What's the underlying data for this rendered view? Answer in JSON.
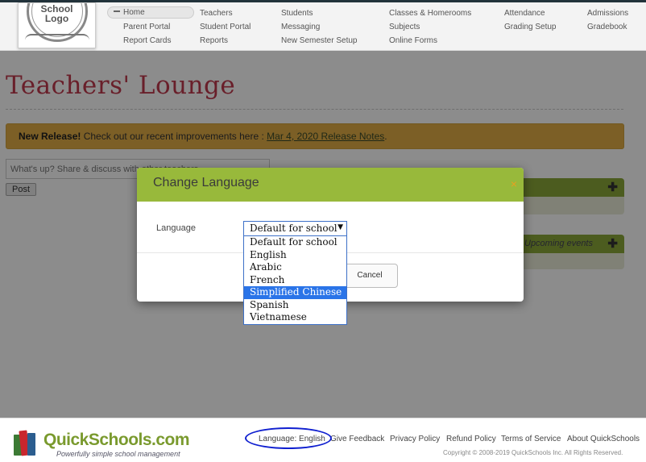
{
  "nav": {
    "home": "Home",
    "parent_portal": "Parent Portal",
    "report_cards": "Report Cards",
    "teachers": "Teachers",
    "student_portal": "Student Portal",
    "reports": "Reports",
    "students": "Students",
    "messaging": "Messaging",
    "new_semester_setup": "New Semester Setup",
    "classes_homerooms": "Classes & Homerooms",
    "subjects": "Subjects",
    "online_forms": "Online Forms",
    "attendance": "Attendance",
    "grading_setup": "Grading Setup",
    "admissions": "Admissions",
    "gradebook": "Gradebook"
  },
  "logo": {
    "line1": "School",
    "line2": "Logo"
  },
  "page_title": "Teachers' Lounge",
  "release": {
    "bold": "New Release!",
    "text": " Check out our recent improvements here : ",
    "link": "Mar 4, 2020 Release Notes",
    "end": "."
  },
  "status": {
    "placeholder": "What's up?  Share & discuss with other teachers",
    "post_label": "Post"
  },
  "panels": {
    "upcoming_events": "Upcoming events"
  },
  "modal": {
    "title": "Change Language",
    "close": "×",
    "language_label": "Language",
    "selected_value": "Default for school",
    "options": [
      "Default for school",
      "English",
      "Arabic",
      "French",
      "Simplified Chinese",
      "Spanish",
      "Vietnamese"
    ],
    "highlighted_option": "Simplified Chinese",
    "cancel_label": "Cancel"
  },
  "footer": {
    "brand": "QuickSchools.com",
    "tagline": "Powerfully simple school management",
    "language": "Language: English",
    "give_feedback": "Give Feedback",
    "privacy_policy": "Privacy Policy",
    "refund_policy": "Refund Policy",
    "terms_of_service": "Terms of Service",
    "about": "About QuickSchools",
    "copyright": "Copyright © 2008-2019 QuickSchools Inc. All Rights Reserved."
  },
  "colors": {
    "accent_green": "#98b93b",
    "title_red": "#c0394d",
    "release_orange": "#e2ad46",
    "select_blue": "#2a74e8",
    "highlight_oval": "#1020d0"
  }
}
